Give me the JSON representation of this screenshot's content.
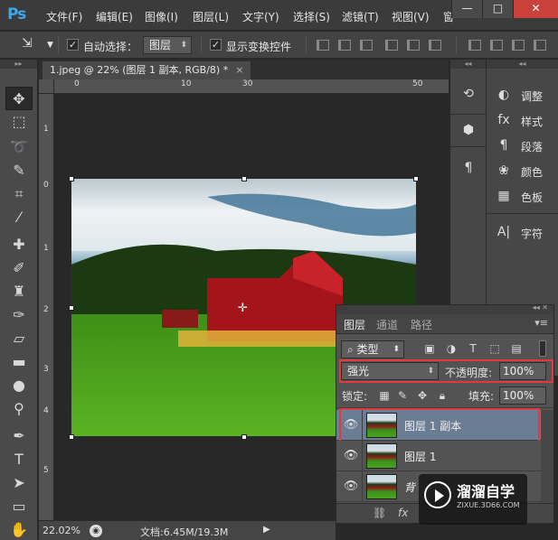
{
  "app": {
    "logo": "Ps"
  },
  "menu": [
    "文件(F)",
    "编辑(E)",
    "图像(I)",
    "图层(L)",
    "文字(Y)",
    "选择(S)",
    "滤镜(T)",
    "视图(V)",
    "窗"
  ],
  "window_controls": {
    "minimize": "—",
    "maximize": "□",
    "close": "✕"
  },
  "options_bar": {
    "auto_select_checked": true,
    "auto_select_label": "自动选择：",
    "auto_select_target": "图层",
    "show_transform_checked": true,
    "show_transform_label": "显示变换控件"
  },
  "document": {
    "tab_title": "1.jpeg @ 22% (图层 1 副本, RGB/8) *",
    "ruler_h_ticks": [
      "0",
      "10",
      "20",
      "30",
      "40",
      "50"
    ],
    "ruler_v_ticks": [
      "1",
      "0",
      "0",
      "1",
      "2",
      "3",
      "4",
      "5"
    ]
  },
  "status_bar": {
    "zoom": "22.02%",
    "doc_info": "文档:6.45M/19.3M"
  },
  "right_dock": [
    {
      "icon": "adjustments-icon",
      "label": "调整"
    },
    {
      "icon": "styles-icon",
      "label": "样式"
    },
    {
      "icon": "paragraph-icon",
      "label": "段落"
    },
    {
      "icon": "swatches-icon",
      "label": "颜色"
    },
    {
      "icon": "color-board-icon",
      "label": "色板"
    },
    {
      "icon": "character-icon",
      "label": "字符"
    }
  ],
  "layers_panel": {
    "tabs": [
      "图层",
      "通道",
      "路径"
    ],
    "active_tab": 0,
    "filter_kind": "类型",
    "blend_mode": "强光",
    "opacity_label": "不透明度:",
    "opacity_value": "100%",
    "lock_label": "锁定:",
    "fill_label": "填充:",
    "fill_value": "100%",
    "layers": [
      {
        "name": "图层 1 副本",
        "selected": true
      },
      {
        "name": "图层 1",
        "selected": false
      },
      {
        "name": "背",
        "selected": false
      }
    ]
  },
  "watermark": {
    "title": "溜溜自学",
    "url": "ZIXUE.3D66.COM"
  },
  "colors": {
    "highlight": "#e23a3a",
    "selected_layer": "#6b7d94",
    "ps_blue": "#3fa7e6"
  }
}
